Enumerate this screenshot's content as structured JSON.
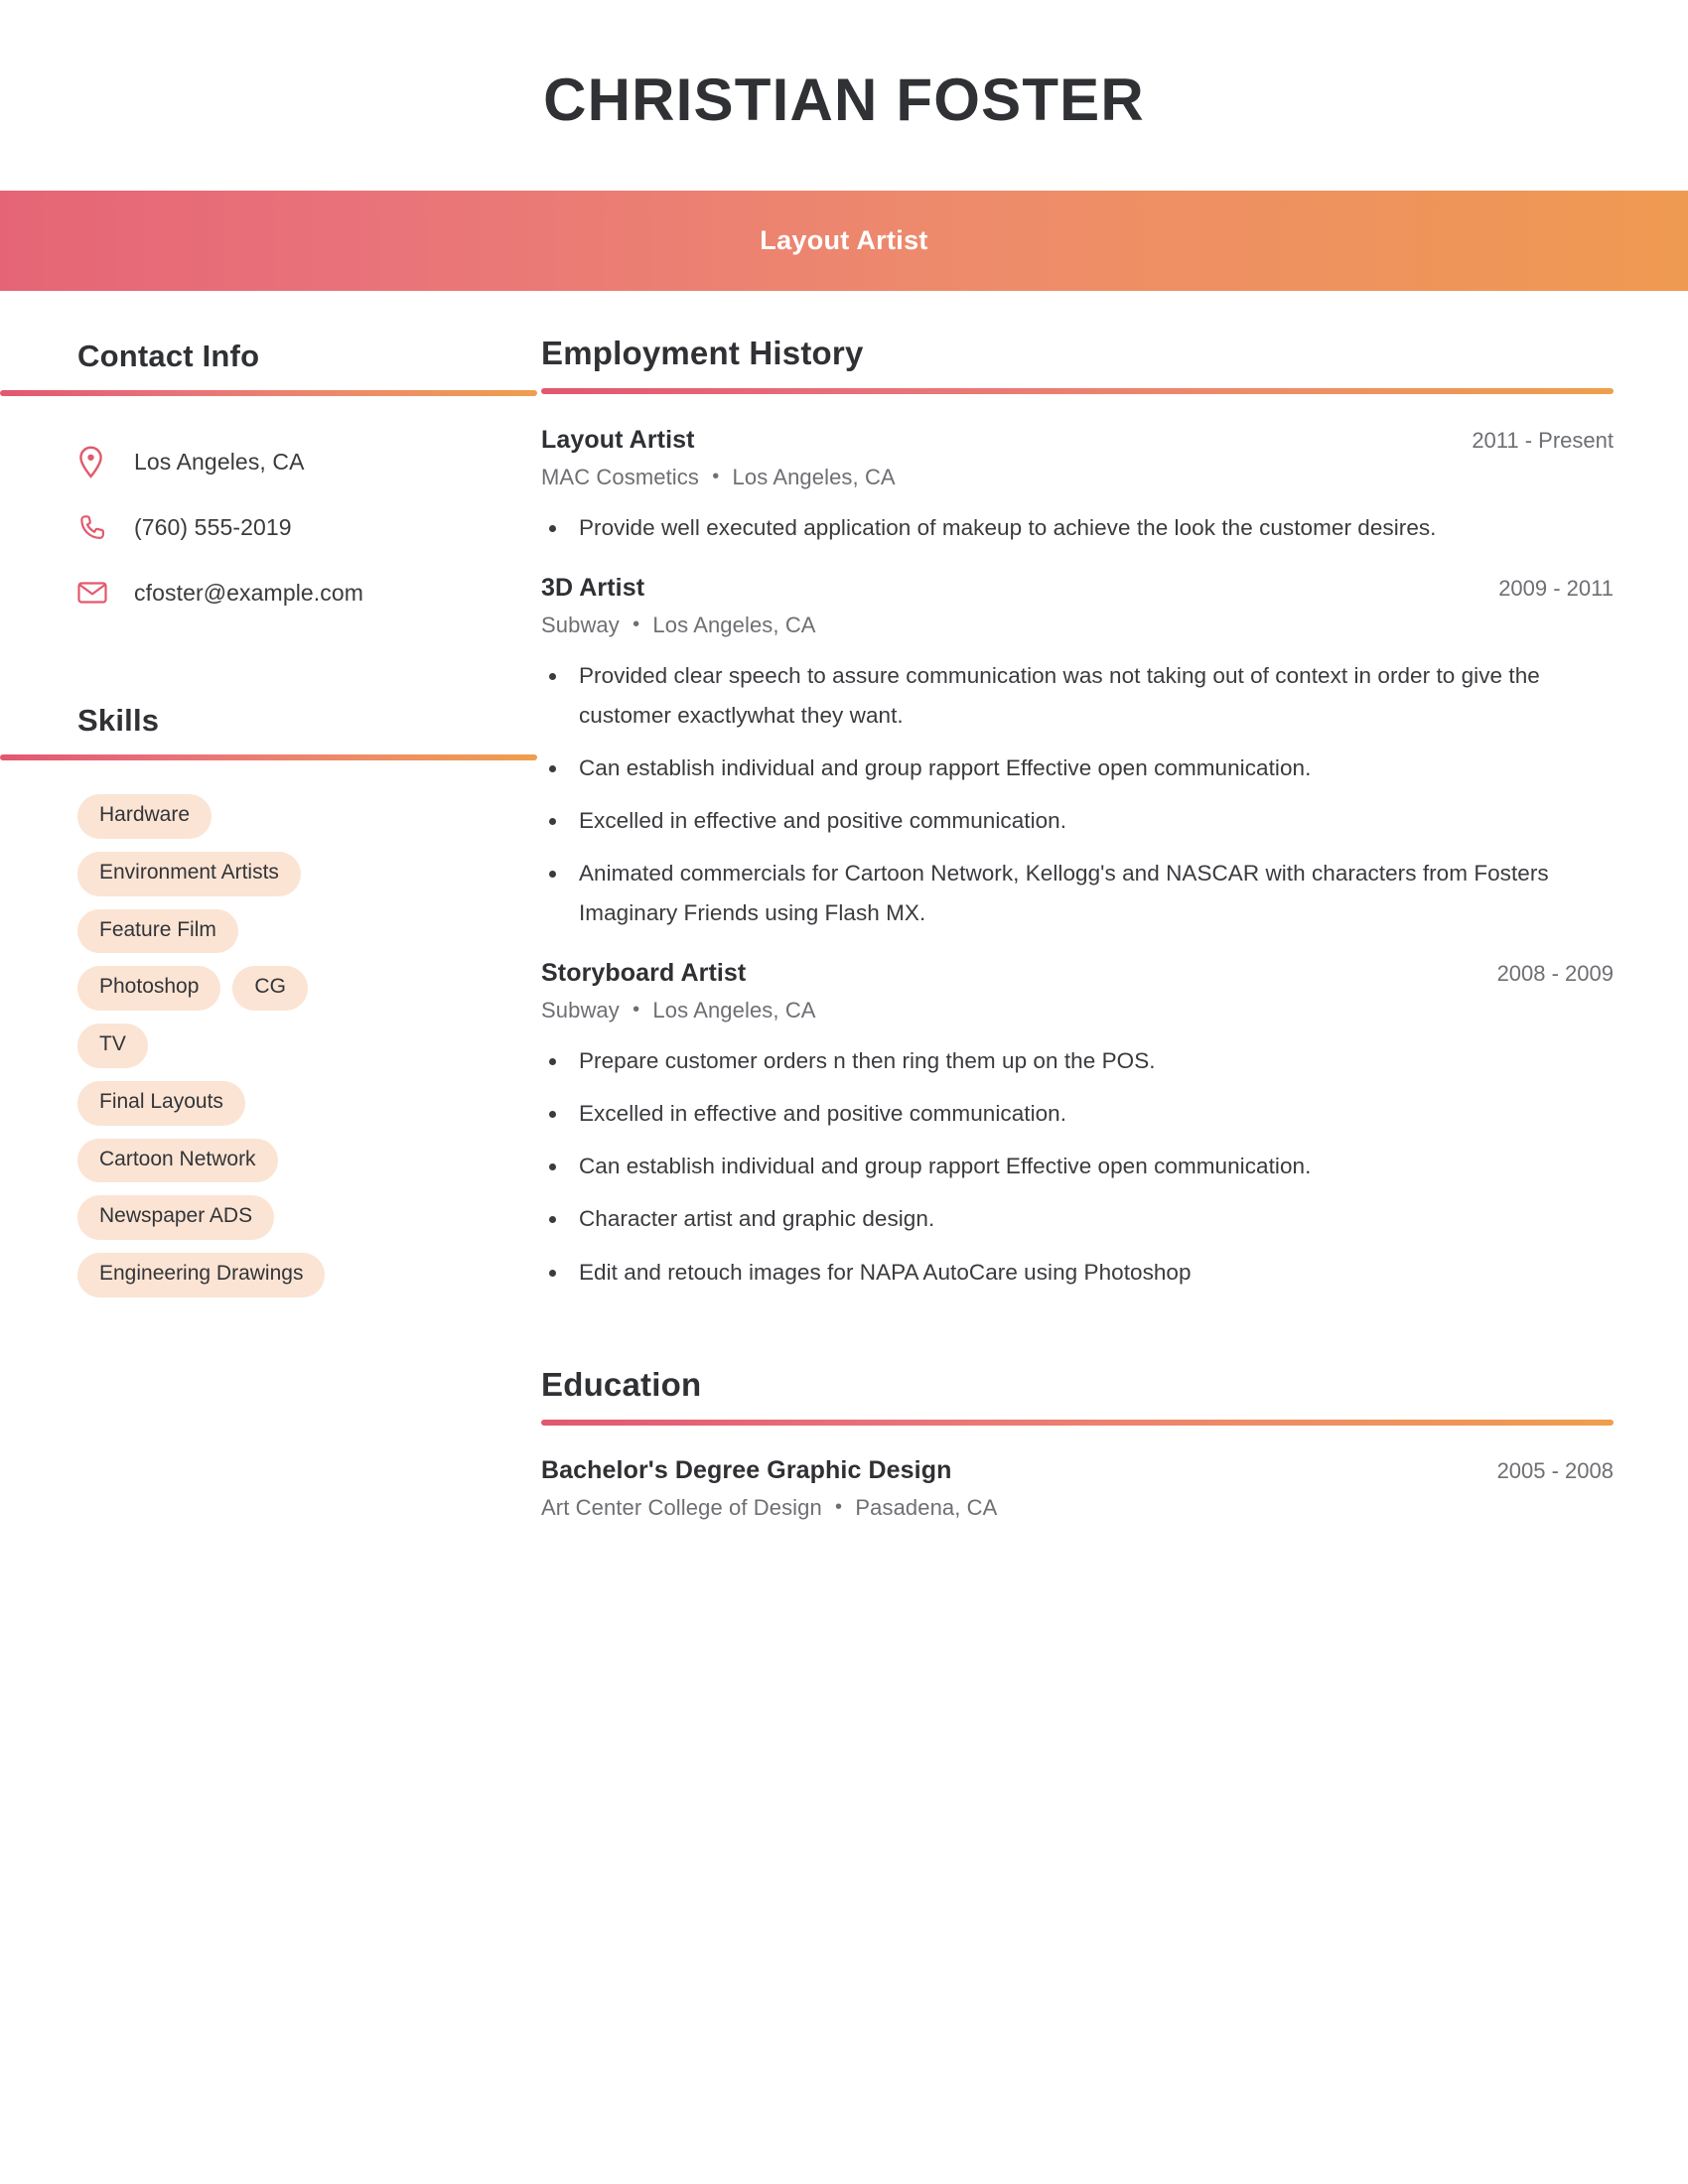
{
  "header": {
    "name": "CHRISTIAN FOSTER",
    "job_title": "Layout Artist",
    "gradient_start": "#e56576",
    "gradient_end": "#ef9a52"
  },
  "sidebar": {
    "contact": {
      "heading": "Contact Info",
      "items": [
        {
          "icon": "location-pin-icon",
          "value": "Los Angeles, CA"
        },
        {
          "icon": "phone-icon",
          "value": "(760) 555-2019"
        },
        {
          "icon": "envelope-icon",
          "value": "cfoster@example.com"
        }
      ]
    },
    "skills": {
      "heading": "Skills",
      "tag_background": "#fbe4d3",
      "items": [
        "Hardware",
        "Environment Artists",
        "Feature Film",
        "Photoshop",
        "CG",
        "TV",
        "Final Layouts",
        "Cartoon Network",
        "Newspaper ADS",
        "Engineering Drawings"
      ]
    }
  },
  "main": {
    "employment": {
      "heading": "Employment History",
      "entries": [
        {
          "title": "Layout Artist",
          "dates": "2011 - Present",
          "company": "MAC Cosmetics",
          "location": "Los Angeles, CA",
          "bullets": [
            "Provide well executed application of makeup to achieve the look the customer desires."
          ]
        },
        {
          "title": "3D Artist",
          "dates": "2009 - 2011",
          "company": "Subway",
          "location": "Los Angeles, CA",
          "bullets": [
            "Provided clear speech to assure communication was not taking out of context in order to give the customer exactlywhat they want.",
            "Can establish individual and group rapport Effective open communication.",
            "Excelled in effective and positive communication.",
            "Animated commercials for Cartoon Network, Kellogg's and NASCAR with characters from Fosters Imaginary Friends using Flash MX."
          ]
        },
        {
          "title": "Storyboard Artist",
          "dates": "2008 - 2009",
          "company": "Subway",
          "location": "Los Angeles, CA",
          "bullets": [
            "Prepare customer orders n then ring them up on the POS.",
            "Excelled in effective and positive communication.",
            "Can establish individual and group rapport Effective open communication.",
            "Character artist and graphic design.",
            "Edit and retouch images for NAPA AutoCare using Photoshop"
          ]
        }
      ]
    },
    "education": {
      "heading": "Education",
      "entries": [
        {
          "title": "Bachelor's Degree Graphic Design",
          "dates": "2005 - 2008",
          "school": "Art Center College of Design",
          "location": "Pasadena, CA"
        }
      ]
    }
  },
  "separator": "•"
}
